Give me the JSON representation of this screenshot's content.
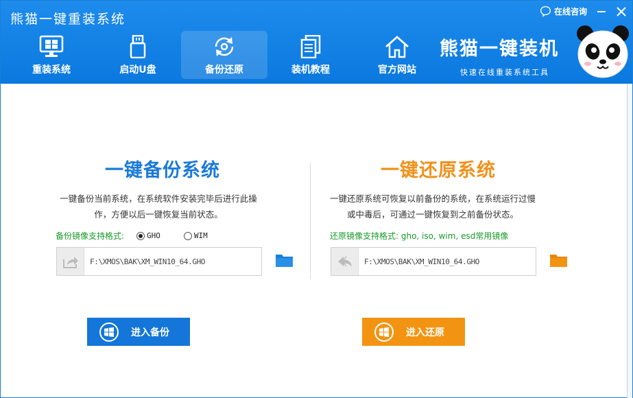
{
  "app": {
    "title": "熊猫一键重装系统",
    "consult_label": "在线咨询",
    "brand_name": "熊猫一键装机",
    "brand_sub": "快速在线重装系统工具"
  },
  "nav": {
    "items": [
      {
        "label": "重装系统",
        "icon": "monitor-icon"
      },
      {
        "label": "启动U盘",
        "icon": "usb-icon"
      },
      {
        "label": "备份还原",
        "icon": "backup-restore-icon",
        "active": true
      },
      {
        "label": "装机教程",
        "icon": "documents-icon"
      },
      {
        "label": "官方网站",
        "icon": "home-icon"
      }
    ]
  },
  "backup": {
    "title": "一键备份系统",
    "desc": "一键备份当前系统，在系统软件安装完毕后进行此操作，方便以后一键恢复当前状态。",
    "formats_label": "备份镜像支持格式:",
    "options": [
      "GHO",
      "WIM"
    ],
    "selected": "GHO",
    "path": "F:\\XMOS\\BAK\\XM_WIN10_64.GHO",
    "button_label": "进入备份"
  },
  "restore": {
    "title": "一键还原系统",
    "desc": "一键还原系统可恢复以前备份的系统，在系统运行过慢或中毒后，可通过一键恢复到之前备份状态。",
    "formats_label": "还原镜像支持格式: gho, iso, wim, esd常用镜像",
    "path": "F:\\XMOS\\BAK\\XM_WIN10_64.GHO",
    "button_label": "进入还原"
  },
  "colors": {
    "header_blue": "#0d7fe5",
    "backup_blue": "#1376d8",
    "restore_orange": "#f29412",
    "format_green": "#199a2a"
  }
}
